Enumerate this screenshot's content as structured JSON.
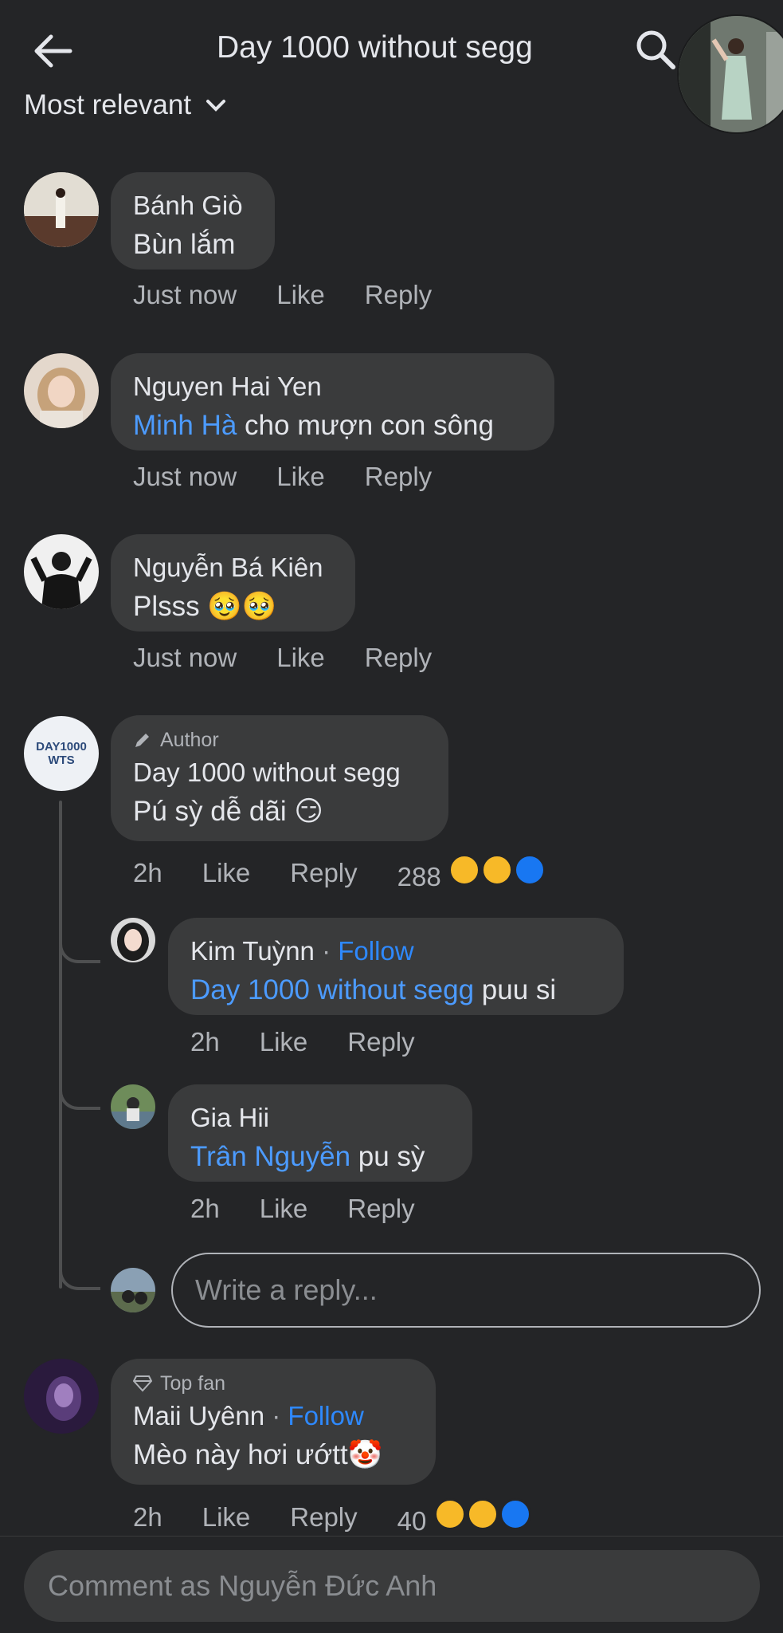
{
  "header": {
    "title": "Day 1000 without segg",
    "back_icon": "arrow-left-icon",
    "search_icon": "search-icon"
  },
  "sort": {
    "label": "Most relevant"
  },
  "comments": [
    {
      "name": "Bánh Giò",
      "text": "Bùn lắm",
      "time": "Just now",
      "like": "Like",
      "reply": "Reply"
    },
    {
      "name": "Nguyen Hai Yen",
      "mention": "Minh Hà",
      "text": " cho mượn con sông",
      "time": "Just now",
      "like": "Like",
      "reply": "Reply"
    },
    {
      "name": "Nguyễn Bá Kiên",
      "text": "Plsss 🥹🥹",
      "time": "Just now",
      "like": "Like",
      "reply": "Reply"
    },
    {
      "badge": "Author",
      "avatar_text_line1": "DAY1000",
      "avatar_text_line2": "WTS",
      "name": "Day 1000 without segg",
      "text": "Pú sỳ dễ dãi 😏",
      "time": "2h",
      "like": "Like",
      "reply": "Reply",
      "reaction_count": "288"
    },
    {
      "name": "Maii Uyênn",
      "badge": "Top fan",
      "follow": "Follow",
      "text": "Mèo này hơi ướtt🤡",
      "time": "2h",
      "like": "Like",
      "reply": "Reply",
      "reaction_count": "40"
    }
  ],
  "replies": [
    {
      "name": "Kim Tuỳnn",
      "follow": "Follow",
      "mention": "Day 1000 without segg",
      "text": " puu si",
      "time": "2h",
      "like": "Like",
      "reply": "Reply"
    },
    {
      "name": "Gia Hii",
      "mention": "Trân Nguyễn",
      "text": " pu sỳ",
      "time": "2h",
      "like": "Like",
      "reply": "Reply"
    }
  ],
  "reply_input": {
    "placeholder": "Write a reply..."
  },
  "comment_input": {
    "placeholder": "Comment as Nguyễn Đức Anh"
  },
  "colors": {
    "background": "#242527",
    "bubble": "#3a3b3c",
    "mention": "#4c9bff",
    "follow": "#2e89ff",
    "secondary_text": "#b0b3b8"
  }
}
